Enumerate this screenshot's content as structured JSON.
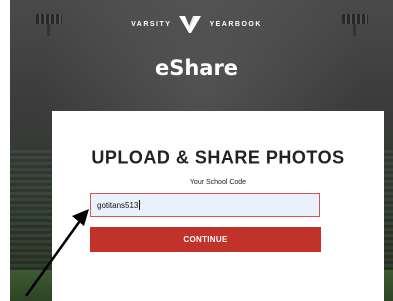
{
  "header": {
    "brand_left": "VARSITY",
    "brand_right": "YEARBOOK",
    "app_title": "eShare"
  },
  "card": {
    "title": "UPLOAD & SHARE PHOTOS",
    "school_code_label": "Your School Code",
    "school_code_value": "gotitans513",
    "continue_label": "CONTINUE"
  },
  "colors": {
    "accent": "#c0322a",
    "input_bg": "#e9f1fd",
    "input_border": "#d9534f"
  },
  "icons": {
    "brand_mark": "varsity-v-logo-icon",
    "annotation": "arrow-icon"
  }
}
